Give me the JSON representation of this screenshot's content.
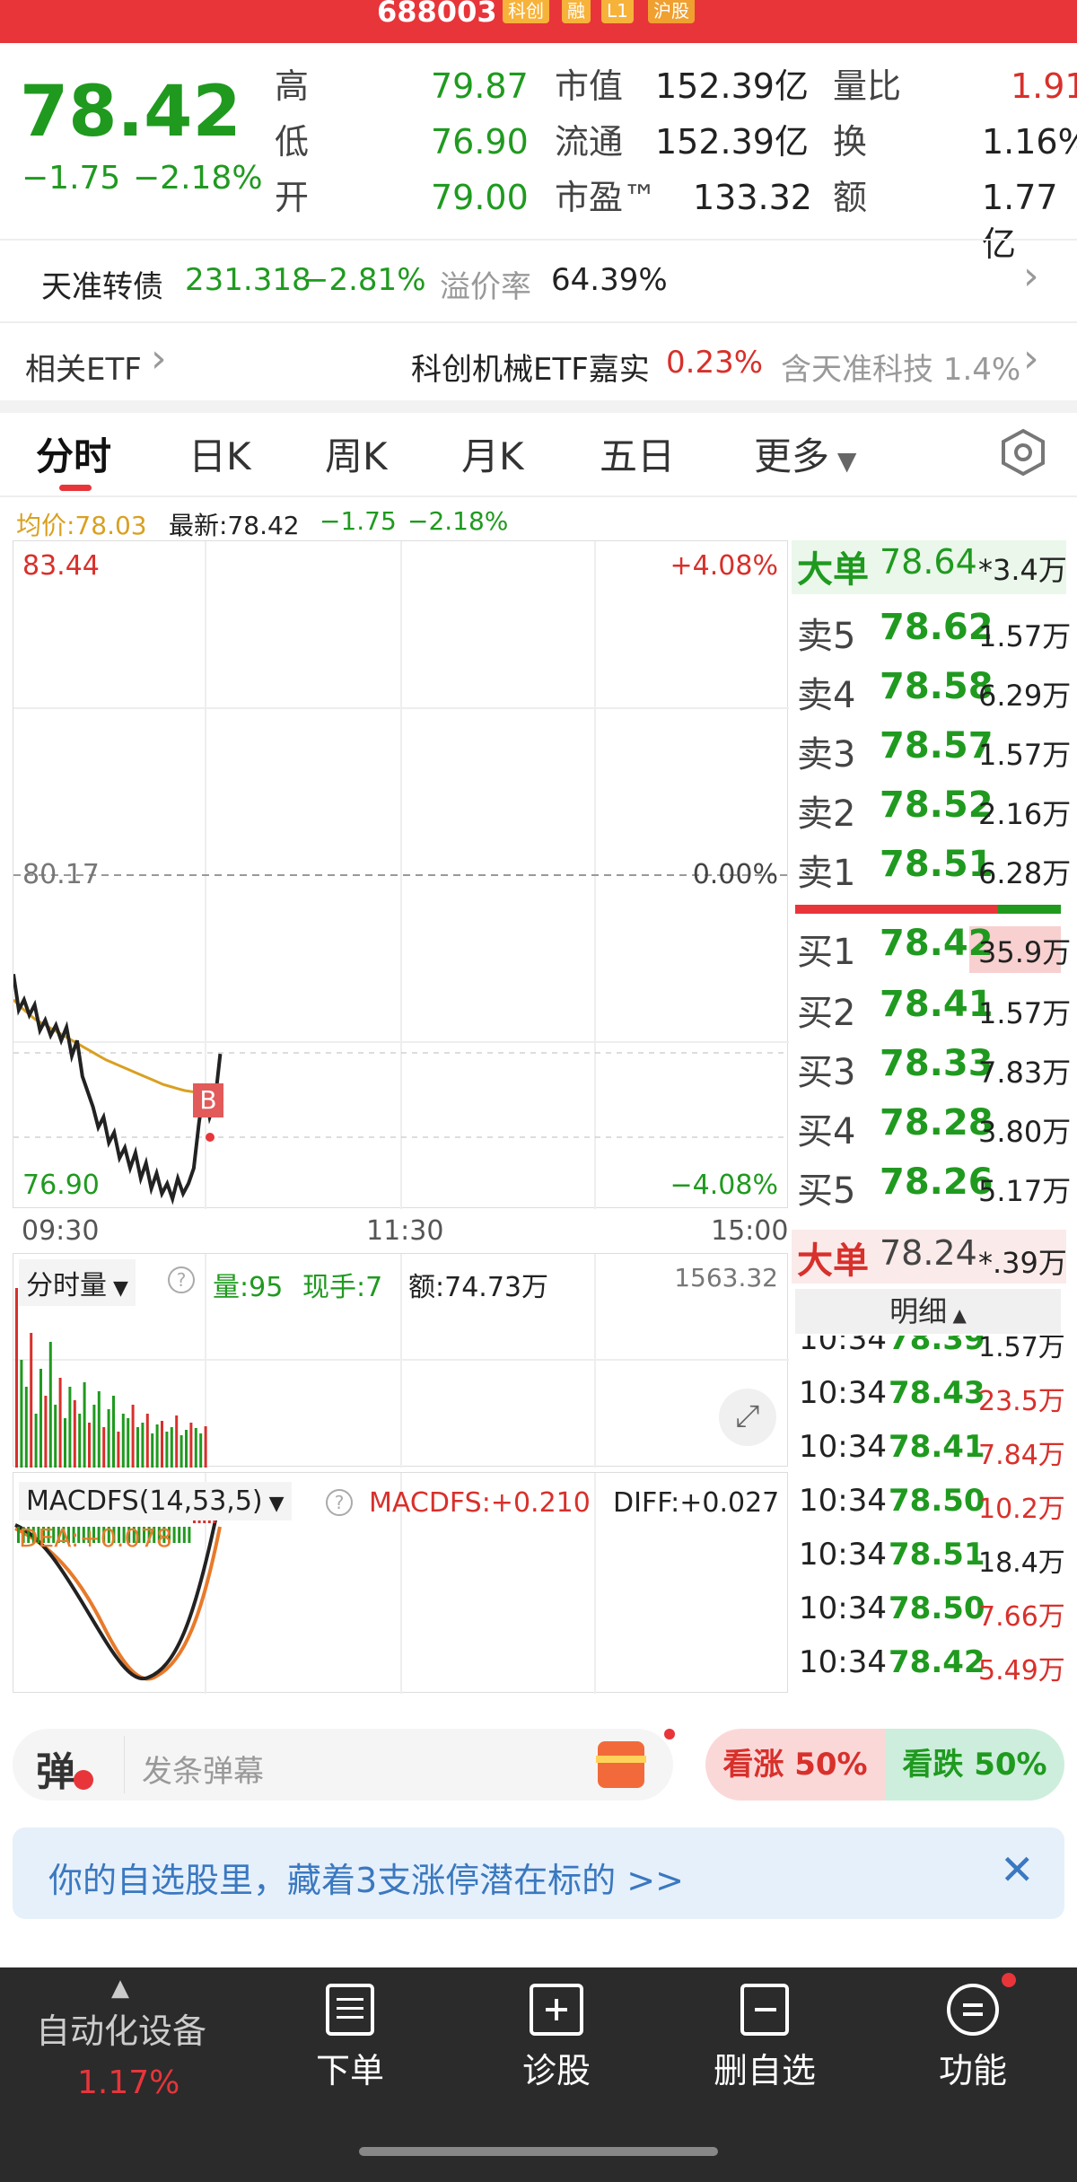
{
  "header": {
    "code": "688003",
    "tags": [
      "科创",
      "融",
      "L1",
      "沪股"
    ]
  },
  "quote": {
    "price": "78.42",
    "change": "−1.75",
    "change_pct": "−2.18%",
    "high_label": "高",
    "high": "79.87",
    "low_label": "低",
    "low": "76.90",
    "open_label": "开",
    "open": "79.00",
    "mcap_label": "市值",
    "mcap": "152.39亿",
    "float_label": "流通",
    "float": "152.39亿",
    "pe_label": "市盈™",
    "pe": "133.32",
    "vol_ratio_label": "量比",
    "vol_ratio": "1.91",
    "turnover_label": "换",
    "turnover": "1.16%",
    "amount_label": "额",
    "amount": "1.77亿"
  },
  "bond": {
    "name": "天准转债",
    "price": "231.318",
    "change_pct": "−2.81%",
    "premium_label": "溢价率",
    "premium": "64.39%"
  },
  "etf": {
    "label": "相关ETF",
    "name": "科创机械ETF嘉实",
    "change": "0.23%",
    "holding": "含天准科技 1.4%"
  },
  "tabs": [
    "分时",
    "日K",
    "周K",
    "月K",
    "五日",
    "更多"
  ],
  "chart_info": {
    "avg": "均价:78.03",
    "latest": "最新:78.42",
    "chg": "−1.75",
    "pct": "−2.18%"
  },
  "chart_data": {
    "type": "line",
    "y_top": "83.44",
    "y_mid": "80.17",
    "y_bot": "76.90",
    "pct_top": "+4.08%",
    "pct_mid": "0.00%",
    "pct_bot": "−4.08%",
    "x_ticks": [
      "09:30",
      "11:30",
      "15:00"
    ],
    "ylim": [
      76.9,
      83.44
    ],
    "price": [
      79.2,
      78.85,
      78.95,
      78.8,
      78.9,
      78.65,
      78.75,
      78.6,
      78.7,
      78.55,
      78.68,
      78.4,
      78.55,
      78.2,
      78.05,
      77.9,
      77.7,
      77.8,
      77.55,
      77.65,
      77.4,
      77.5,
      77.3,
      77.45,
      77.2,
      77.35,
      77.1,
      77.25,
      77.05,
      77.15,
      77.0,
      77.2,
      77.05,
      77.15,
      77.3,
      77.75,
      78.1,
      77.8,
      77.95,
      78.42
    ],
    "avg": [
      78.95,
      78.88,
      78.82,
      78.76,
      78.72,
      78.68,
      78.64,
      78.6,
      78.56,
      78.52,
      78.48,
      78.44,
      78.4,
      78.36,
      78.33,
      78.3,
      78.27,
      78.24,
      78.21,
      78.18,
      78.15,
      78.12,
      78.1,
      78.08,
      78.06,
      78.05,
      78.04,
      78.03,
      78.03,
      78.03
    ],
    "marker": "B"
  },
  "volume_panel": {
    "title": "分时量",
    "vol": "量:95",
    "now": "现手:7",
    "amount": "额:74.73万",
    "max": "1563.32"
  },
  "macd_panel": {
    "title": "MACDFS(14,53,5)",
    "macdfs": "MACDFS:+0.210",
    "diff": "DIFF:+0.027",
    "dea": "DEA:+0.078"
  },
  "orderbook": {
    "big_top": {
      "label": "大单",
      "price": "78.64",
      "vol": "*3.4万"
    },
    "asks": [
      {
        "label": "卖5",
        "price": "78.62",
        "vol": "1.57万"
      },
      {
        "label": "卖4",
        "price": "78.58",
        "vol": "6.29万"
      },
      {
        "label": "卖3",
        "price": "78.57",
        "vol": "1.57万"
      },
      {
        "label": "卖2",
        "price": "78.52",
        "vol": "2.16万"
      },
      {
        "label": "卖1",
        "price": "78.51",
        "vol": "6.28万"
      }
    ],
    "bids": [
      {
        "label": "买1",
        "price": "78.42",
        "vol": "35.9万"
      },
      {
        "label": "买2",
        "price": "78.41",
        "vol": "1.57万"
      },
      {
        "label": "买3",
        "price": "78.33",
        "vol": "7.83万"
      },
      {
        "label": "买4",
        "price": "78.28",
        "vol": "3.80万"
      },
      {
        "label": "买5",
        "price": "78.26",
        "vol": "5.17万"
      }
    ],
    "big_bottom": {
      "label": "大单",
      "price": "78.24",
      "vol": "*.39万"
    },
    "detail_label": "明细"
  },
  "ticks": [
    {
      "time": "10:34",
      "price": "78.39",
      "vol": "1.57万"
    },
    {
      "time": "10:34",
      "price": "78.43",
      "vol": "23.5万"
    },
    {
      "time": "10:34",
      "price": "78.41",
      "vol": "7.84万"
    },
    {
      "time": "10:34",
      "price": "78.50",
      "vol": "10.2万"
    },
    {
      "time": "10:34",
      "price": "78.51",
      "vol": "18.4万"
    },
    {
      "time": "10:34",
      "price": "78.50",
      "vol": "7.66万"
    },
    {
      "time": "10:34",
      "price": "78.42",
      "vol": "5.49万"
    }
  ],
  "danmu": {
    "icon": "弹",
    "placeholder": "发条弹幕",
    "up": "看涨 50%",
    "down": "看跌 50%"
  },
  "banner": {
    "text": "你的自选股里，藏着3支涨停潜在标的 >>"
  },
  "bottom_nav": {
    "sector": "自动化设备",
    "sector_pct": "1.17%",
    "items": [
      "下单",
      "诊股",
      "删自选",
      "功能"
    ]
  },
  "colors": {
    "red": "#d8302b",
    "green": "#1f9a1f",
    "nav_bg": "#2b2b2b"
  }
}
